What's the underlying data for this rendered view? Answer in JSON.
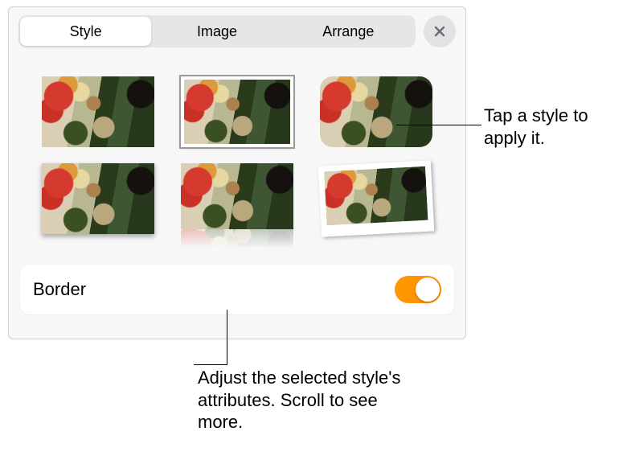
{
  "tabs": {
    "style": "Style",
    "image": "Image",
    "arrange": "Arrange"
  },
  "border": {
    "label": "Border",
    "on": true
  },
  "callouts": {
    "tap_style": "Tap a style to apply it.",
    "adjust": "Adjust the selected style's attributes. Scroll to see more."
  },
  "selected_style_index": 1
}
